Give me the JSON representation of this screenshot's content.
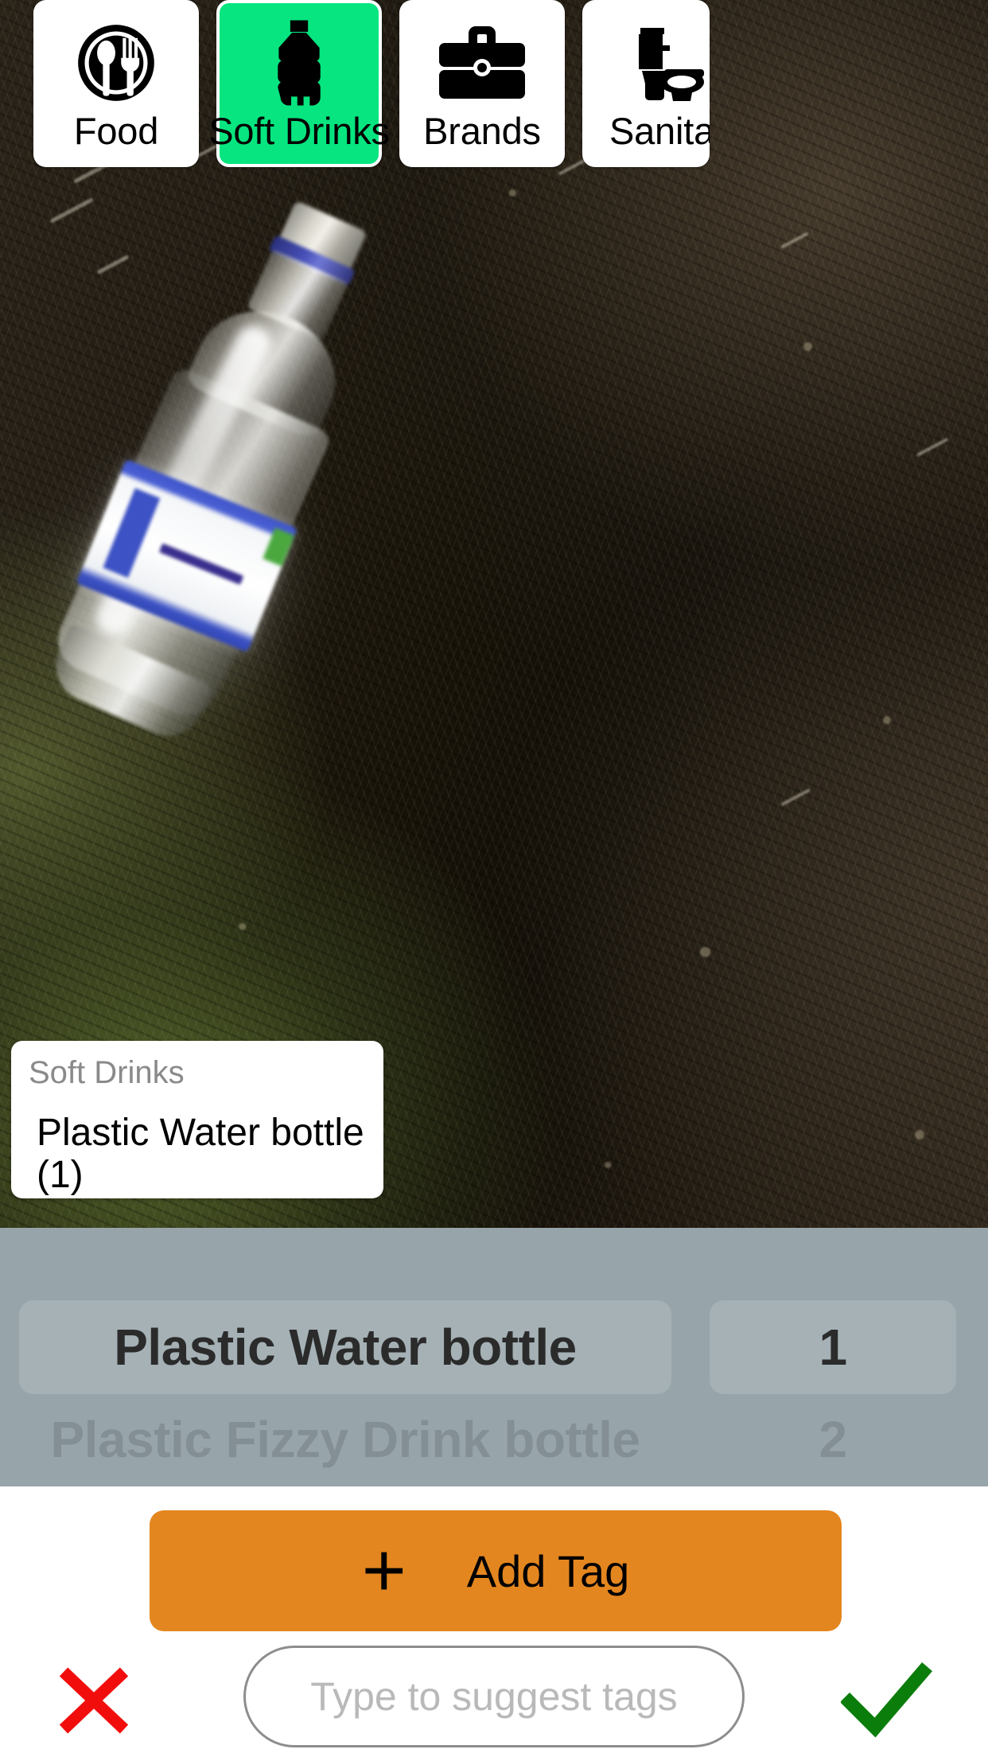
{
  "categories": {
    "tabs": [
      {
        "label": "Food",
        "icon": "plate-cutlery-icon",
        "selected": false
      },
      {
        "label": "Soft Drinks",
        "icon": "soft-drink-bottle-icon",
        "selected": true
      },
      {
        "label": "Brands",
        "icon": "briefcase-icon",
        "selected": false
      },
      {
        "label": "Sanita",
        "icon": "toilet-icon",
        "selected": false
      }
    ],
    "selected_color": "#06e57f"
  },
  "tag_card": {
    "category": "Soft Drinks",
    "item": "Plastic Water bottle  (1)"
  },
  "picker": {
    "background_color": "#97a5aa",
    "selection_color": "#a5b1b5",
    "rows": [
      {
        "name": "Plastic Water bottle",
        "qty": "1",
        "state": "selected"
      },
      {
        "name": "Plastic Fizzy Drink bottle",
        "qty": "2",
        "state": "below"
      }
    ]
  },
  "bottom": {
    "add_tag_label": "Add Tag",
    "add_tag_plus": "+",
    "add_tag_color": "#e4861f",
    "suggest_placeholder": "Type to suggest tags",
    "suggest_value": "",
    "cancel_icon": "red-x-icon",
    "cancel_color": "#f20d0d",
    "confirm_icon": "green-check-icon",
    "confirm_color": "#0b7d0b"
  }
}
